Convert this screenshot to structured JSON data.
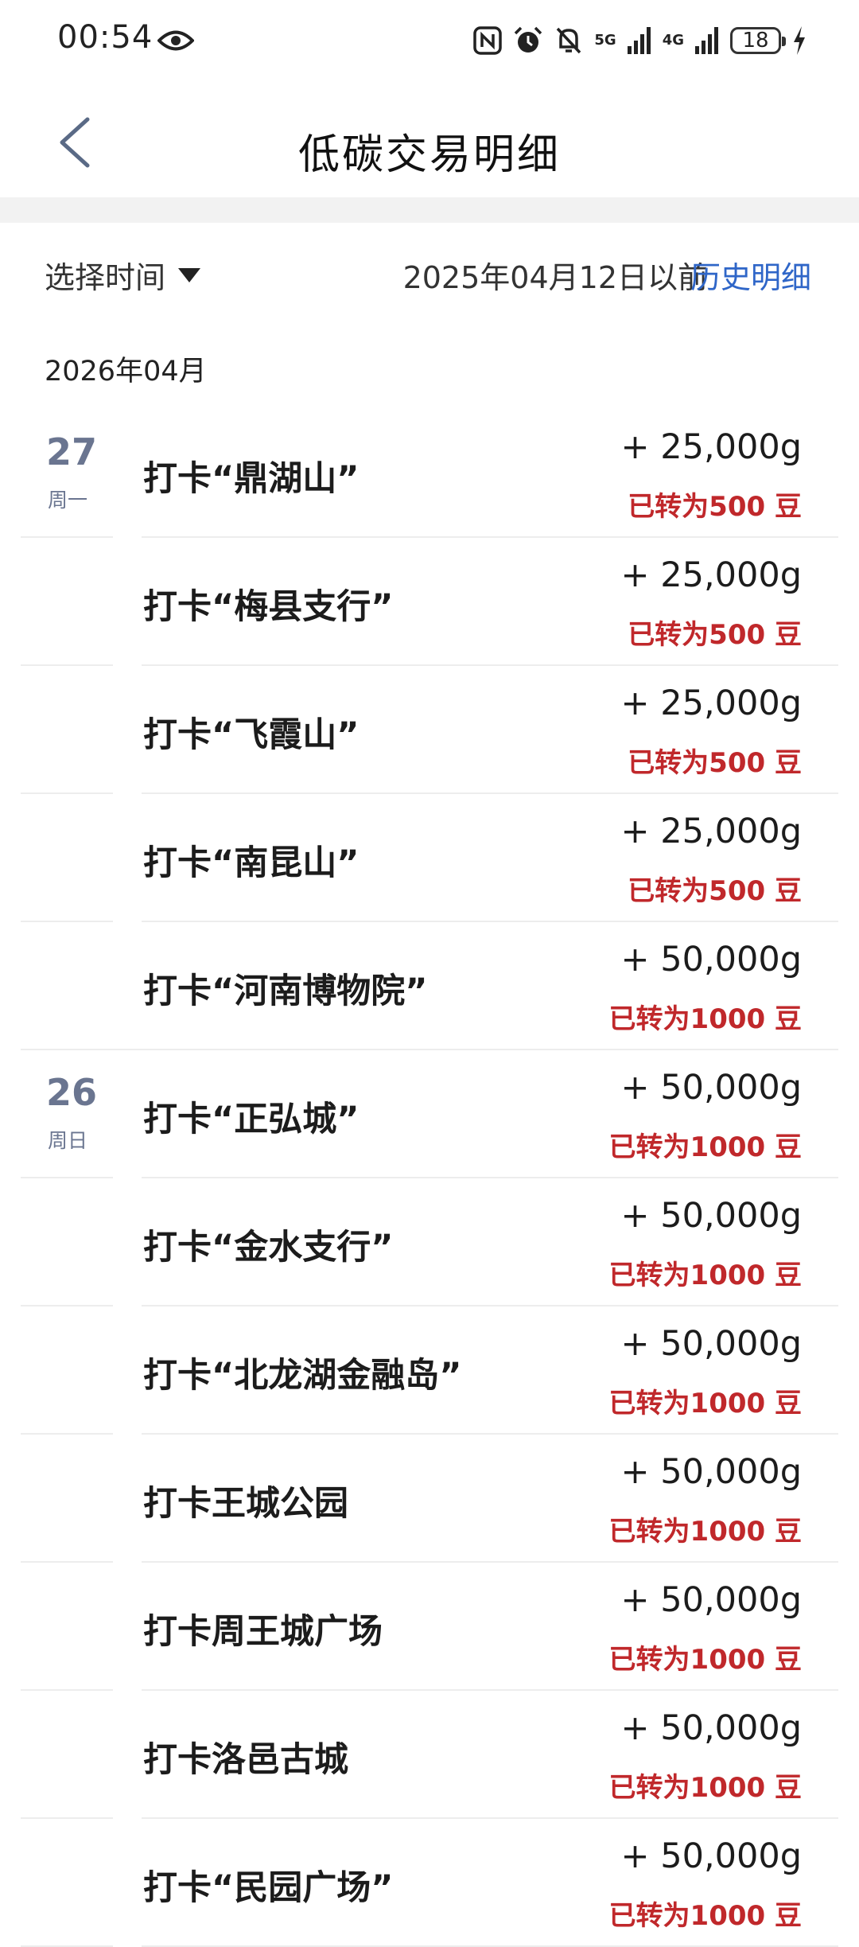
{
  "status_bar": {
    "time": "00:54",
    "battery": "18",
    "network_1": "5G",
    "network_2": "4G",
    "icons": [
      "eye-icon",
      "nfc-icon",
      "alarm-icon",
      "mute-icon",
      "signal-icon",
      "battery-icon",
      "charging-icon"
    ]
  },
  "header": {
    "title": "低碳交易明细",
    "back_icon": "chevron-left-icon"
  },
  "filter": {
    "select_time_label": "选择时间",
    "before_label": "2025年04月12日以前",
    "history_label": "历史明细",
    "accent_color": "#2f66c8"
  },
  "month_label": "2026年04月",
  "colors": {
    "converted_text": "#c0282b",
    "date_text": "#6a7590"
  },
  "records": [
    {
      "day": "27",
      "weekday": "周一",
      "name": "打卡“鼎湖山”",
      "amount": "+ 25,000g",
      "converted": "已转为500 豆"
    },
    {
      "day": "",
      "weekday": "",
      "name": "打卡“梅县支行”",
      "amount": "+ 25,000g",
      "converted": "已转为500 豆"
    },
    {
      "day": "",
      "weekday": "",
      "name": "打卡“飞霞山”",
      "amount": "+ 25,000g",
      "converted": "已转为500 豆"
    },
    {
      "day": "",
      "weekday": "",
      "name": "打卡“南昆山”",
      "amount": "+ 25,000g",
      "converted": "已转为500 豆"
    },
    {
      "day": "",
      "weekday": "",
      "name": "打卡“河南博物院”",
      "amount": "+ 50,000g",
      "converted": "已转为1000 豆",
      "group_end": true
    },
    {
      "day": "26",
      "weekday": "周日",
      "name": "打卡“正弘城”",
      "amount": "+ 50,000g",
      "converted": "已转为1000 豆"
    },
    {
      "day": "",
      "weekday": "",
      "name": "打卡“金水支行”",
      "amount": "+ 50,000g",
      "converted": "已转为1000 豆"
    },
    {
      "day": "",
      "weekday": "",
      "name": "打卡“北龙湖金融岛”",
      "amount": "+ 50,000g",
      "converted": "已转为1000 豆"
    },
    {
      "day": "",
      "weekday": "",
      "name": "打卡王城公园",
      "amount": "+ 50,000g",
      "converted": "已转为1000 豆"
    },
    {
      "day": "",
      "weekday": "",
      "name": "打卡周王城广场",
      "amount": "+ 50,000g",
      "converted": "已转为1000 豆"
    },
    {
      "day": "",
      "weekday": "",
      "name": "打卡洛邑古城",
      "amount": "+ 50,000g",
      "converted": "已转为1000 豆"
    },
    {
      "day": "",
      "weekday": "",
      "name": "打卡“民园广场”",
      "amount": "+ 50,000g",
      "converted": "已转为1000 豆"
    }
  ]
}
